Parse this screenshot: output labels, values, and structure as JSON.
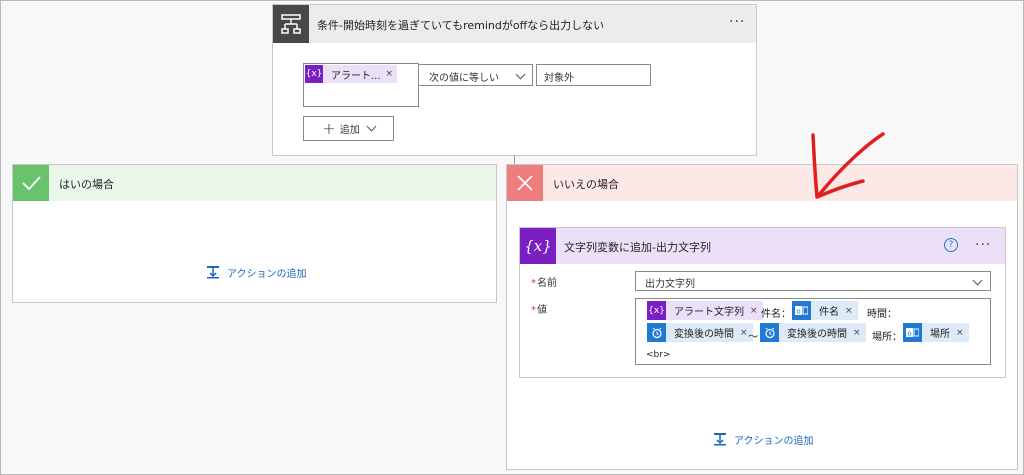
{
  "condition": {
    "title": "条件-開始時刻を過ぎていてもremindがoffなら出力しない",
    "menu": "···",
    "left_token": {
      "icon": "{x}",
      "label": "アラート...",
      "remove": "×"
    },
    "operator": "次の値に等しい",
    "right_value": "対象外",
    "add_label": "追加"
  },
  "yes_branch": {
    "title": "はいの場合",
    "add_action": "アクションの追加"
  },
  "no_branch": {
    "title": "いいえの場合",
    "add_action": "アクションの追加",
    "action": {
      "icon": "{x}",
      "title": "文字列変数に追加-出力文字列",
      "help": "?",
      "menu": "···",
      "name_label": "名前",
      "required_mark": "*",
      "name_value": "出力文字列",
      "value_label": "値",
      "tokens": {
        "alert": {
          "icon": "{x}",
          "label": "アラート文字列",
          "remove": "×"
        },
        "subject": {
          "label": "件名",
          "remove": "×"
        },
        "time1": {
          "label": "変換後の時間",
          "remove": "×"
        },
        "time2": {
          "label": "変換後の時間",
          "remove": "×"
        },
        "location": {
          "label": "場所",
          "remove": "×"
        }
      },
      "text_subject": "件名：",
      "text_time": "時間：",
      "text_tilde": "～",
      "text_place": "場所：",
      "text_br": "<br>"
    }
  },
  "colors": {
    "yes": "#68c36c",
    "no": "#ee7d7d",
    "variable": "#7a1fc2",
    "outlook": "#1f7ad6",
    "arrow": "#e02020"
  }
}
